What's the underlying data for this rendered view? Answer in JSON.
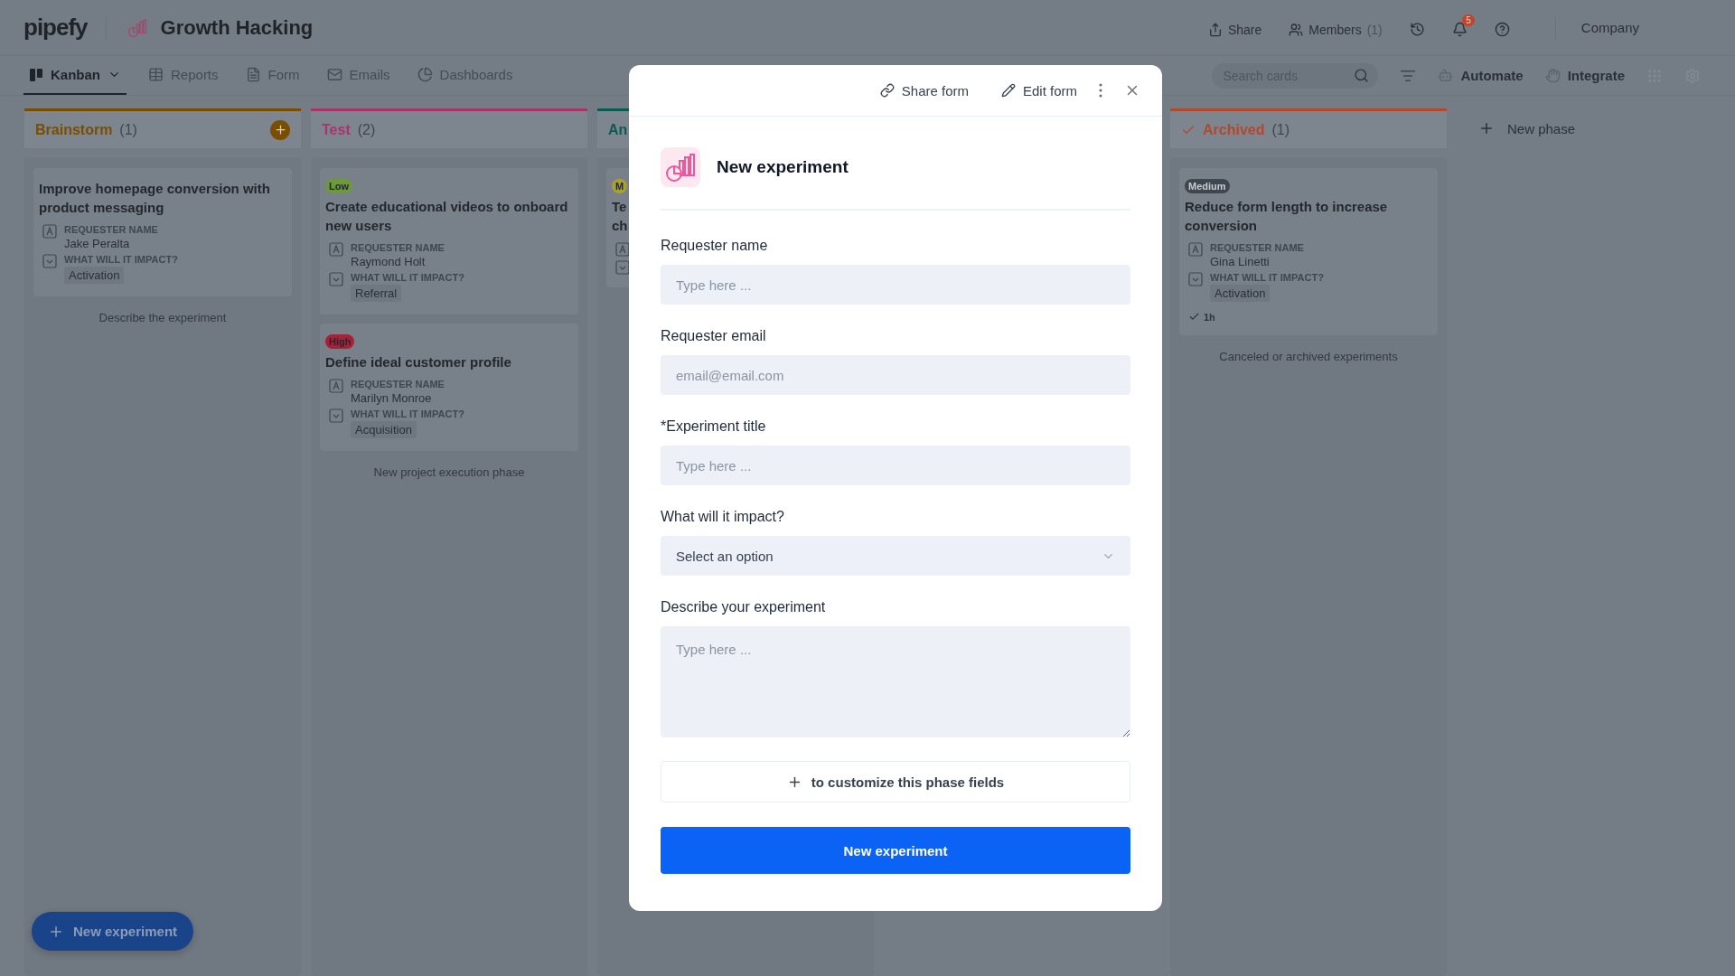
{
  "header": {
    "logo": "pipefy",
    "title": "Growth Hacking",
    "share": "Share",
    "members": {
      "label": "Members",
      "count": "(1)"
    },
    "notifications": "5",
    "company": "Company"
  },
  "nav": {
    "tabs": [
      {
        "label": "Kanban",
        "selected": true,
        "kind": "kanban"
      },
      {
        "label": "Reports",
        "selected": false,
        "kind": "reports"
      },
      {
        "label": "Form",
        "selected": false,
        "kind": "form"
      },
      {
        "label": "Emails",
        "selected": false,
        "kind": "emails"
      },
      {
        "label": "Dashboards",
        "selected": false,
        "kind": "dashboards"
      }
    ],
    "search": {
      "placeholder": "Search cards"
    },
    "automate": "Automate",
    "integrate": "Integrate"
  },
  "columns": [
    {
      "title": "Brainstorm",
      "count": "(1)",
      "color": "#7a4e00",
      "done": false,
      "add_button": true,
      "footer": "Describe the experiment",
      "cards": [
        {
          "title": "Improve homepage conversion with product messaging",
          "fields": [
            {
              "kind": "text",
              "label": "REQUESTER NAME",
              "value": "Jake Peralta"
            },
            {
              "kind": "select",
              "label": "WHAT WILL IT IMPACT?",
              "value": "Activation"
            }
          ]
        }
      ]
    },
    {
      "title": "Test",
      "count": "(2)",
      "color": "#a8346c",
      "done": false,
      "add_button": false,
      "footer": "New project execution phase",
      "cards": [
        {
          "badge": {
            "label": "Low",
            "color": "#6c9a3a"
          },
          "title": "Create educational videos to onboard new users",
          "fields": [
            {
              "kind": "text",
              "label": "REQUESTER NAME",
              "value": "Raymond Holt"
            },
            {
              "kind": "select",
              "label": "WHAT WILL IT IMPACT?",
              "value": "Referral"
            }
          ]
        },
        {
          "badge": {
            "label": "High",
            "color": "#a52238"
          },
          "title": "Define ideal customer profile",
          "fields": [
            {
              "kind": "text",
              "label": "REQUESTER NAME",
              "value": "Marilyn Monroe"
            },
            {
              "kind": "select",
              "label": "WHAT WILL IT IMPACT?",
              "value": "Acquisition"
            }
          ]
        }
      ]
    },
    {
      "title": "An",
      "color": "#0a5c52",
      "done": false,
      "cards": [
        {
          "badge": {
            "label": "M",
            "color": "#a8a030"
          },
          "title": "Te\nch",
          "fields": [
            {
              "kind": "text"
            },
            {
              "kind": "select"
            }
          ]
        }
      ]
    },
    {
      "title": "Archived",
      "count": "(1)",
      "color": "#b04a2e",
      "done": true,
      "add_button": false,
      "footer": "Canceled or archived experiments",
      "cards": [
        {
          "badge": {
            "label": "Medium",
            "color": "#3f4650"
          },
          "title": "Reduce form length to increase conversion",
          "fields": [
            {
              "kind": "text",
              "label": "REQUESTER NAME",
              "value": "Gina Linetti"
            },
            {
              "kind": "select",
              "label": "WHAT WILL IT IMPACT?",
              "value": "Activation"
            }
          ],
          "time": "1h"
        }
      ]
    }
  ],
  "new_phase": "New phase",
  "fab": "New experiment",
  "modal": {
    "share_form": "Share form",
    "edit_form": "Edit form",
    "title": "New experiment",
    "fields": [
      {
        "kind": "text",
        "label": "Requester name",
        "placeholder": "Type here ..."
      },
      {
        "kind": "text",
        "label": "Requester email",
        "placeholder": "email@email.com"
      },
      {
        "kind": "text",
        "label": "*Experiment title",
        "placeholder": "Type here ..."
      },
      {
        "kind": "select",
        "label": "What will it impact?",
        "placeholder": "Select an option"
      },
      {
        "kind": "textarea",
        "label": "Describe your experiment",
        "placeholder": "Type here ..."
      }
    ],
    "customize": "to customize this phase fields",
    "submit": "New experiment"
  }
}
